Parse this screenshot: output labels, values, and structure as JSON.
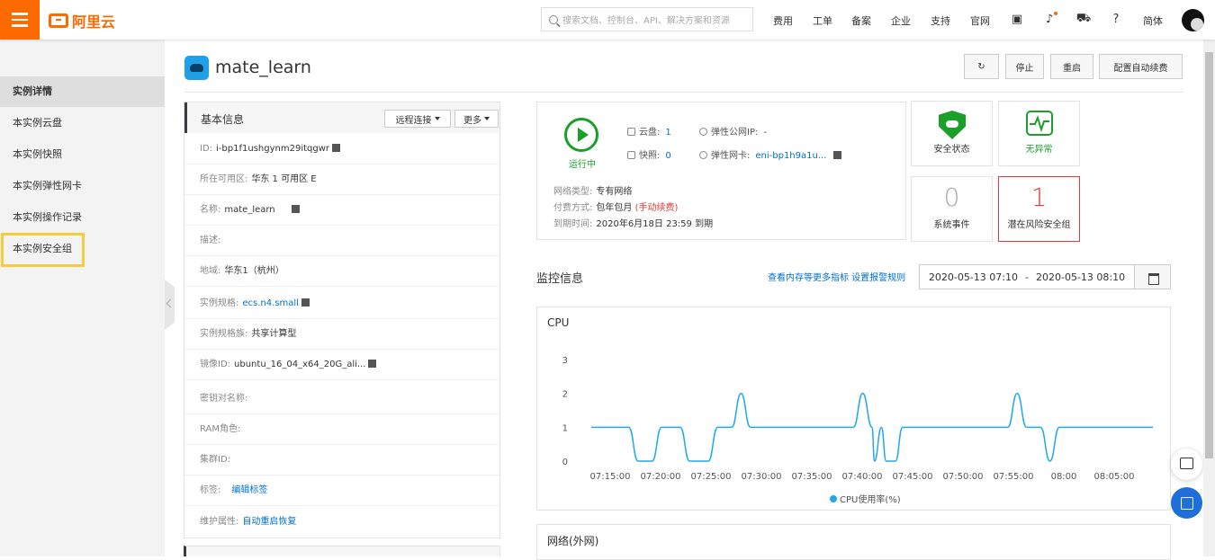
{
  "topbar": {
    "logo_text": "阿里云",
    "search_placeholder": "搜索文档、控制台、API、解决方案和资源",
    "nav": [
      "费用",
      "工单",
      "备案",
      "企业",
      "支持",
      "官网"
    ],
    "lang": "简体",
    "icons": [
      "terminal-icon",
      "bell-icon",
      "cart-icon",
      "help-icon"
    ]
  },
  "sidebar": {
    "items": [
      {
        "label": "实例详情",
        "active": true
      },
      {
        "label": "本实例云盘"
      },
      {
        "label": "本实例快照"
      },
      {
        "label": "本实例弹性网卡"
      },
      {
        "label": "本实例操作记录"
      },
      {
        "label": "本实例安全组",
        "highlighted": true
      }
    ]
  },
  "instance": {
    "name": "mate_learn",
    "actions": {
      "refresh_icon": "refresh-icon",
      "stop": "停止",
      "restart": "重启",
      "auto_renew": "配置自动续费"
    }
  },
  "basic_info": {
    "title": "基本信息",
    "remote_btn": "远程连接",
    "more_btn": "更多",
    "rows": [
      {
        "k": "ID:",
        "v": "i-bp1f1ushgynm29itqgwr"
      },
      {
        "k": "所在可用区:",
        "v": "华东 1 可用区 E"
      },
      {
        "k": "名称:",
        "v": "mate_learn"
      },
      {
        "k": "描述:",
        "v": ""
      },
      {
        "k": "地域:",
        "v": "华东1（杭州）"
      },
      {
        "k": "实例规格:",
        "v": "ecs.n4.small"
      },
      {
        "k": "实例规格族:",
        "v": "共享计算型"
      },
      {
        "k": "镜像ID:",
        "v": "ubuntu_16_04_x64_20G_ali..."
      },
      {
        "k": "密钥对名称:",
        "v": ""
      },
      {
        "k": "RAM角色:",
        "v": ""
      },
      {
        "k": "集群ID:",
        "v": ""
      },
      {
        "k": "标签:",
        "v": "编辑标签"
      },
      {
        "k": "维护属性:",
        "v": "自动重启恢复"
      }
    ]
  },
  "status": {
    "running": "运行中",
    "disk_label": "云盘:",
    "disk_count": "1",
    "snapshot_label": "快照:",
    "snapshot_count": "0",
    "eip_label": "弹性公网IP:",
    "eip_value": "-",
    "eni_label": "弹性网卡:",
    "eni_value": "eni-bp1h9a1u...",
    "net_type_label": "网络类型:",
    "net_type": "专有网络",
    "pay_label": "付费方式:",
    "pay": "包年包月",
    "pay_note": "(手动续费)",
    "expire_label": "到期时间:",
    "expire": "2020年6月18日 23:59 到期"
  },
  "tiles": {
    "security_state": "安全状态",
    "no_anomaly": "无异常",
    "sys_events_count": "0",
    "sys_events": "系统事件",
    "risk_count": "1",
    "risk": "潜在风险安全组"
  },
  "monitor": {
    "title": "监控信息",
    "links": "查看内存等更多指标 设置报警规则",
    "from": "2020-05-13 07:10",
    "sep": "-",
    "to": "2020-05-13 08:10"
  },
  "chart_data": {
    "type": "line",
    "title": "CPU",
    "x_ticks": [
      "07:15:00",
      "07:20:00",
      "07:25:00",
      "07:30:00",
      "07:35:00",
      "07:40:00",
      "07:45:00",
      "07:50:00",
      "07:55:00",
      "08:00",
      "08:05:00"
    ],
    "ylim": [
      0,
      3
    ],
    "y_ticks": [
      0,
      1,
      2,
      3
    ],
    "grid": false,
    "legend": "bottom",
    "series": [
      {
        "name": "CPU使用率(%)",
        "color": "#20a8e8",
        "points": [
          [
            0,
            1
          ],
          [
            0.8,
            1
          ],
          [
            1.0,
            0
          ],
          [
            1.3,
            0
          ],
          [
            1.5,
            1
          ],
          [
            1.9,
            1
          ],
          [
            2.1,
            0
          ],
          [
            2.5,
            0
          ],
          [
            2.7,
            1
          ],
          [
            3.0,
            1
          ],
          [
            3.2,
            2
          ],
          [
            3.4,
            1
          ],
          [
            5.6,
            1
          ],
          [
            5.8,
            2
          ],
          [
            6.0,
            1
          ],
          [
            6.05,
            0
          ],
          [
            6.2,
            1
          ],
          [
            6.3,
            0
          ],
          [
            6.5,
            0
          ],
          [
            6.65,
            1
          ],
          [
            8.9,
            1
          ],
          [
            9.1,
            2
          ],
          [
            9.3,
            1
          ],
          [
            9.6,
            1
          ],
          [
            9.8,
            0
          ],
          [
            10.0,
            1
          ],
          [
            12,
            1
          ]
        ]
      }
    ]
  },
  "network_card": {
    "title": "网络(外网)"
  }
}
